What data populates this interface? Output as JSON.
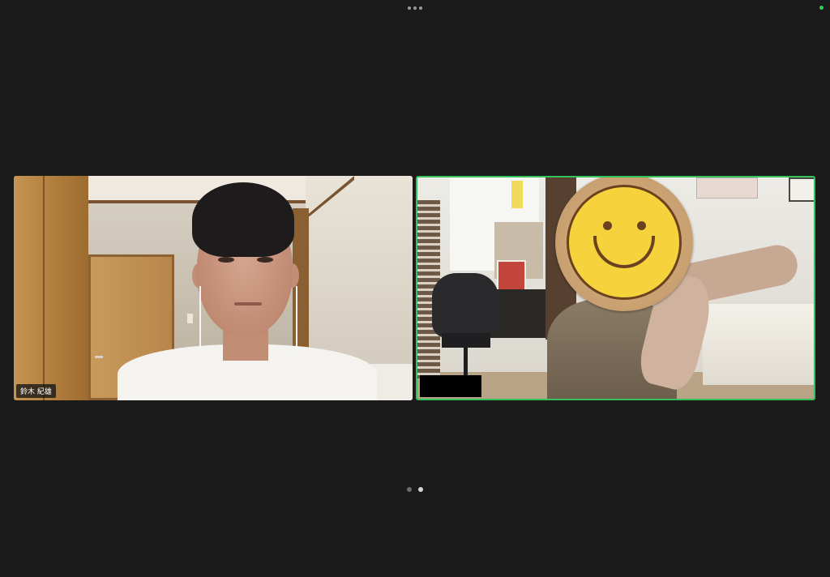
{
  "toolbar": {
    "more_icon": "more-horizontal-icon"
  },
  "status": {
    "indicator_color": "#2fd05a"
  },
  "participants": [
    {
      "name": "鈴木 紀雄",
      "active_speaker": false
    },
    {
      "name": "",
      "active_speaker": true,
      "highlight_color": "#35c25a",
      "mask_icon": "smiley-face-icon"
    }
  ],
  "pagination": {
    "pages": 2,
    "current_page": 2
  }
}
